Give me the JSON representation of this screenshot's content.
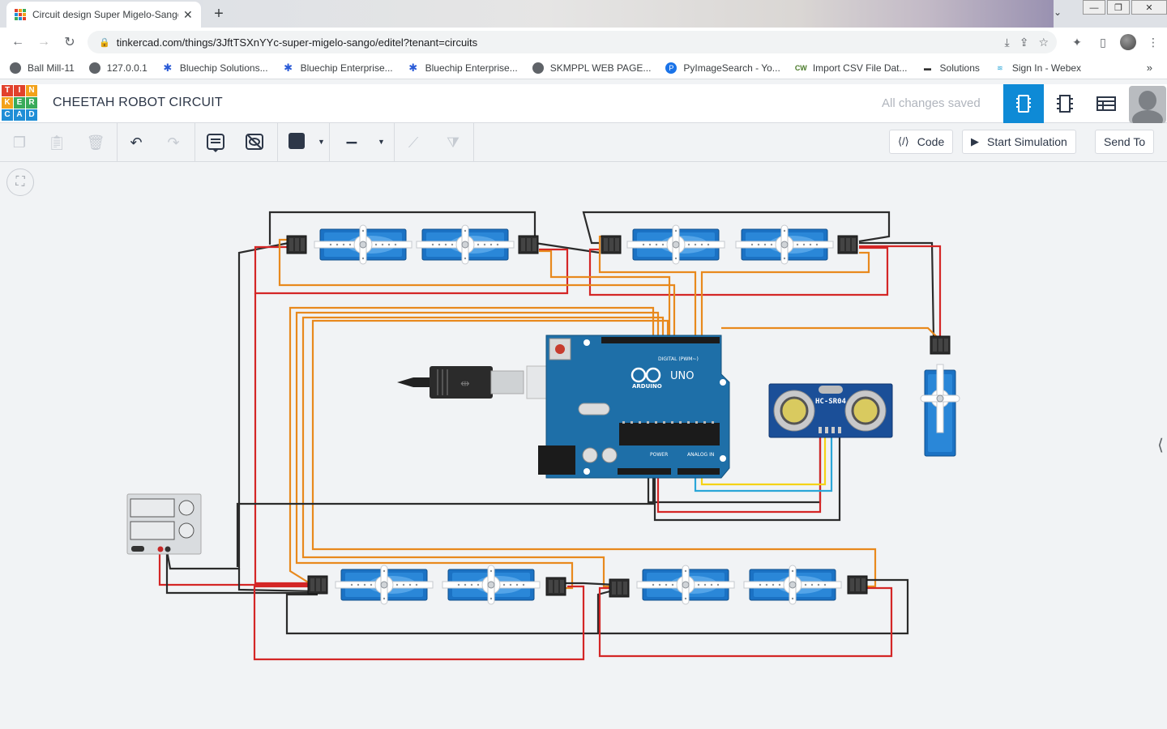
{
  "browser": {
    "tab_title": "Circuit design Super Migelo-Sango",
    "url": "tinkercad.com/things/3JftTSXnYYc-super-migelo-sango/editel?tenant=circuits",
    "bookmarks": [
      {
        "label": "Ball Mill-11",
        "icon": "globe-icon"
      },
      {
        "label": "127.0.0.1",
        "icon": "globe-icon"
      },
      {
        "label": "Bluechip Solutions...",
        "icon": "star-icon"
      },
      {
        "label": "Bluechip Enterprise...",
        "icon": "star-icon"
      },
      {
        "label": "Bluechip Enterprise...",
        "icon": "star-icon"
      },
      {
        "label": "SKMPPL WEB PAGE...",
        "icon": "globe-icon"
      },
      {
        "label": "PyImageSearch - Yo...",
        "icon": "p-icon"
      },
      {
        "label": "Import CSV File Dat...",
        "icon": "cw-icon"
      },
      {
        "label": "Solutions",
        "icon": "dash-icon"
      },
      {
        "label": "Sign In - Webex",
        "icon": "webex-icon"
      }
    ]
  },
  "app": {
    "logo_letters": [
      "T",
      "I",
      "N",
      "K",
      "E",
      "R",
      "C",
      "A",
      "D"
    ],
    "logo_colors": [
      "#e2412c",
      "#e2412c",
      "#f3a21a",
      "#f3a21a",
      "#39ab5a",
      "#39ab5a",
      "#1f8ed6",
      "#1f8ed6",
      "#1f8ed6"
    ],
    "project_title": "CHEETAH ROBOT CIRCUIT",
    "save_status": "All changes saved",
    "accent": "#0e8ad6"
  },
  "toolbar": {
    "code_label": "Code",
    "simulate_label": "Start Simulation",
    "send_label": "Send To"
  },
  "canvas": {
    "arduino": {
      "model": "UNO",
      "brand": "ARDUINO",
      "header_label": "DIGITAL (PWM~)",
      "power_label": "POWER",
      "analog_label": "ANALOG IN"
    },
    "ultrasonic": {
      "model": "HC-SR04"
    },
    "wire_colors": {
      "power": "#d42626",
      "ground": "#2b2b2b",
      "signal": "#e8891d",
      "trig": "#f5d316",
      "echo": "#2aa6d8"
    }
  }
}
